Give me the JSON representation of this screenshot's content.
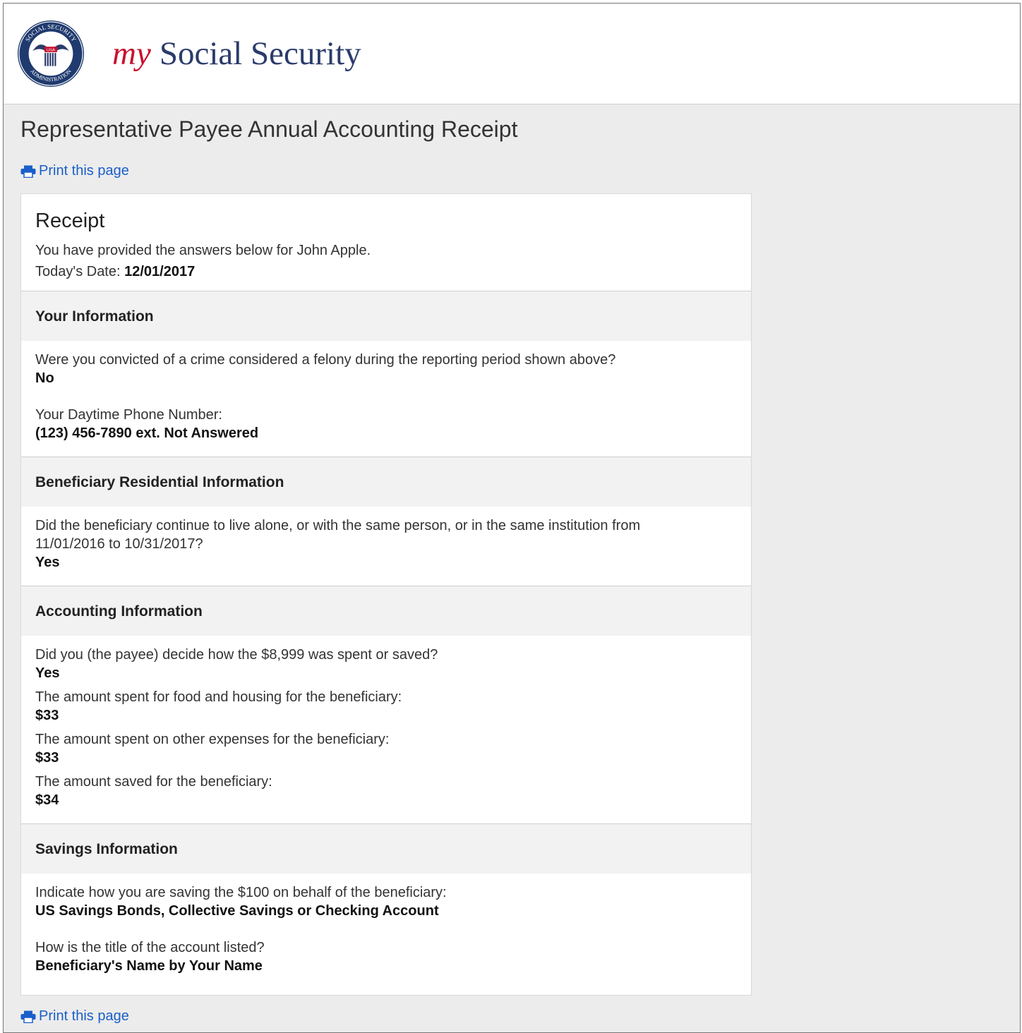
{
  "header": {
    "brand_my": "my",
    "brand_name": "Social Security",
    "seal_text_top": "SOCIAL SECURITY",
    "seal_text_bottom": "ADMINISTRATION",
    "seal_center": "USA"
  },
  "page": {
    "title": "Representative Payee Annual Accounting Receipt",
    "print_label": "Print this page",
    "print_label_bottom": "Print this page"
  },
  "receipt": {
    "heading": "Receipt",
    "intro": "You have provided the answers below for John Apple.",
    "date_label": "Today's Date:",
    "date_value": "12/01/2017"
  },
  "sections": {
    "your_info": {
      "heading": "Your Information",
      "q1": "Were you convicted of a crime considered a felony during the reporting period shown above?",
      "a1": "No",
      "q2": "Your Daytime Phone Number:",
      "a2": "(123) 456-7890 ext. Not Answered"
    },
    "residential": {
      "heading": "Beneficiary Residential Information",
      "q1": "Did the beneficiary continue to live alone, or with the same person, or in the same institution from 11/01/2016 to 10/31/2017?",
      "a1": "Yes"
    },
    "accounting": {
      "heading": "Accounting Information",
      "q1": "Did you (the payee) decide how the $8,999 was spent or saved?",
      "a1": "Yes",
      "q2": "The amount spent for food and housing for the beneficiary:",
      "a2": "$33",
      "q3": "The amount spent on other expenses for the beneficiary:",
      "a3": "$33",
      "q4": "The amount saved for the beneficiary:",
      "a4": "$34"
    },
    "savings": {
      "heading": "Savings Information",
      "q1": "Indicate how you are saving the $100 on behalf of the beneficiary:",
      "a1": "US Savings Bonds, Collective Savings or Checking Account",
      "q2": "How is the title of the account listed?",
      "a2": "Beneficiary's Name by Your Name"
    }
  },
  "colors": {
    "brand_red": "#c8102e",
    "brand_navy": "#2b3b6b",
    "link_blue": "#1a5fc9",
    "page_bg": "#ececec"
  },
  "icons": [
    "ssa-seal-icon",
    "printer-icon"
  ]
}
